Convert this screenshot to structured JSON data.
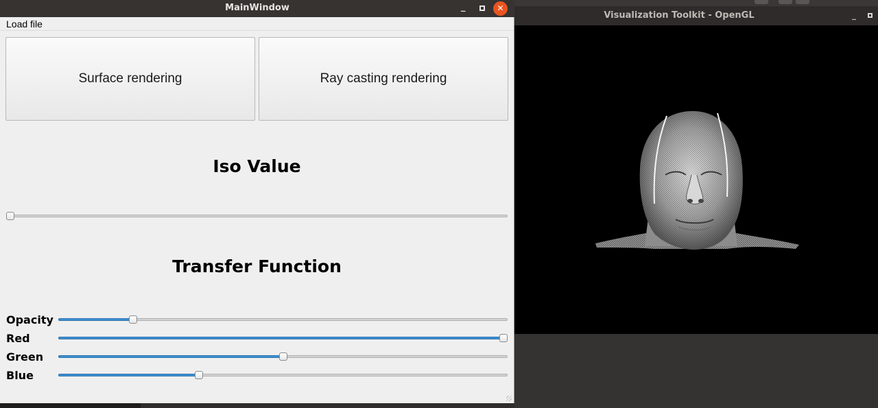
{
  "main_window": {
    "title": "MainWindow",
    "menu": {
      "load_file": "Load file"
    },
    "buttons": {
      "surface": "Surface rendering",
      "raycast": "Ray casting rendering"
    },
    "iso": {
      "heading": "Iso Value",
      "value": 0.0
    },
    "transfer": {
      "heading": "Transfer Function",
      "opacity": {
        "label": "Opacity",
        "value": 0.16
      },
      "red": {
        "label": "Red",
        "value": 1.0
      },
      "green": {
        "label": "Green",
        "value": 0.5
      },
      "blue": {
        "label": "Blue",
        "value": 0.31
      }
    }
  },
  "vtk_window": {
    "title": "Visualization Toolkit - OpenGL"
  },
  "colors": {
    "accent": "#3d8fd1",
    "close": "#e95420"
  }
}
